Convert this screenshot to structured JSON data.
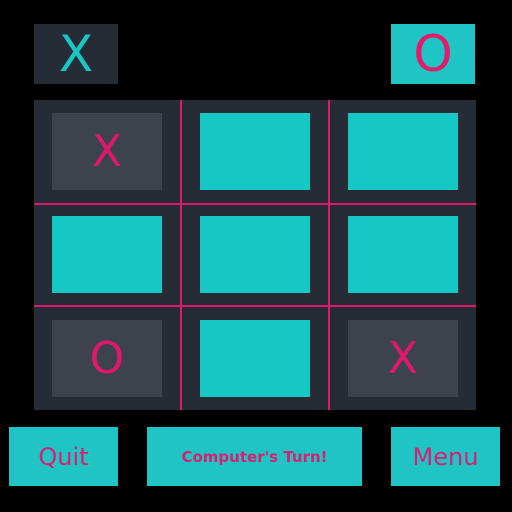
{
  "players": {
    "x_indicator": "X",
    "o_indicator": "O"
  },
  "board": {
    "cells": [
      "X",
      "",
      "",
      "",
      "",
      "",
      "O",
      "",
      "X"
    ]
  },
  "buttons": {
    "quit_label": "Quit",
    "status_label": "Computer's Turn!",
    "menu_label": "Menu"
  },
  "colors": {
    "background": "#000000",
    "board_bg": "#262c35",
    "cell_empty": "#15c7c5",
    "cell_filled": "#3c434c",
    "grid_lines": "#e0186a",
    "mark_pink": "#e0186a",
    "mark_cyan": "#19c6c4"
  }
}
